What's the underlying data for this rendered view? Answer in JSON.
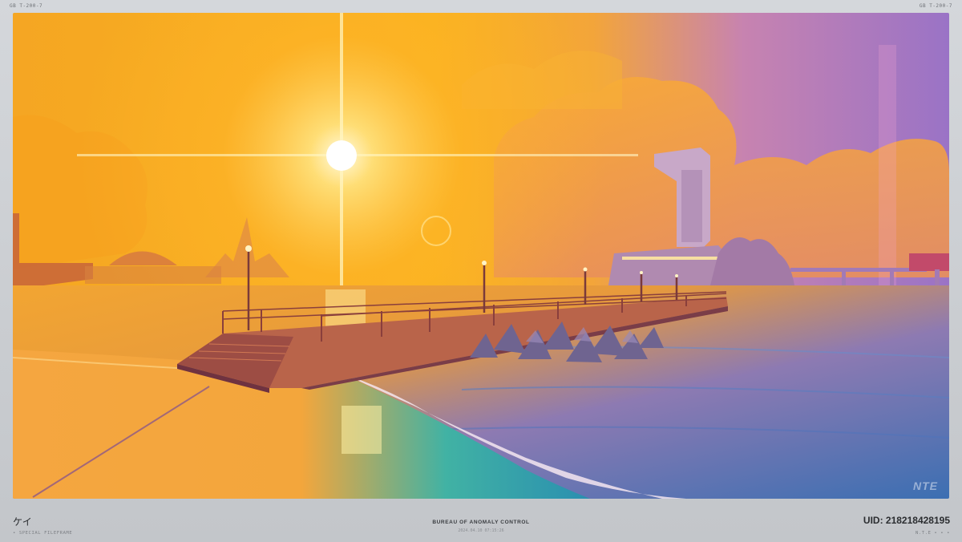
{
  "top_meta": {
    "left": "GB    T-200-7",
    "right": "GB    T-200-7"
  },
  "photo": {
    "description_colors": {
      "sky_gold": "#f7a21b",
      "sky_purple": "#9b72c4",
      "sea_blue": "#3f6fb0"
    },
    "watermark": "NTE"
  },
  "footer": {
    "name": "ケイ",
    "left_caption": "• SPECIAL FILEFRAME",
    "center_title": "BUREAU OF ANOMALY CONTROL",
    "center_date": "2024.04.10  07:15:26",
    "uid": "UID: 218218428195",
    "right_caption": "N.T.E • • •"
  }
}
